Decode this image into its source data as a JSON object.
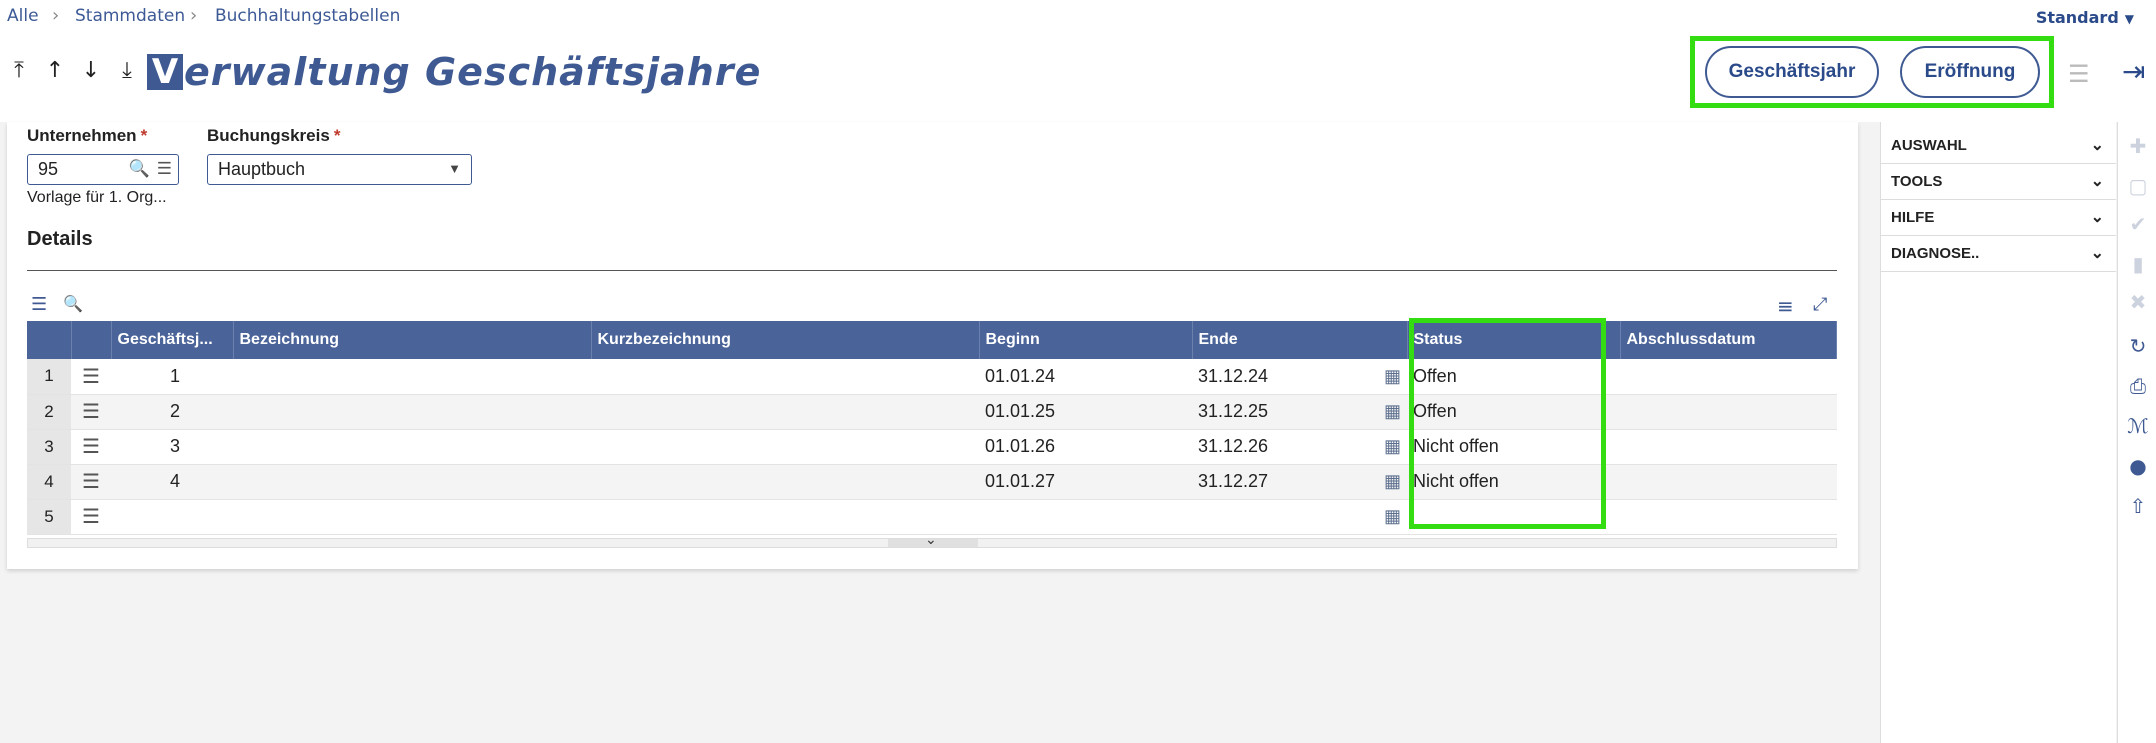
{
  "breadcrumb": {
    "items": [
      "Alle",
      "Stammdaten",
      "Buchhaltungstabellen"
    ]
  },
  "layout_selector": {
    "label": "Standard"
  },
  "title": {
    "logo_letter": "V",
    "text": "erwaltung Geschäftsjahre"
  },
  "header_buttons": {
    "fiscal_year": "Geschäftsjahr",
    "opening": "Eröffnung"
  },
  "form": {
    "company_label": "Unternehmen",
    "company_value": "95",
    "company_hint": "Vorlage für 1. Org...",
    "booking_label": "Buchungskreis",
    "booking_value": "Hauptbuch",
    "required_mark": "*"
  },
  "details_title": "Details",
  "table": {
    "columns": [
      "Geschäftsj...",
      "Bezeichnung",
      "Kurzbezeichnung",
      "Beginn",
      "Ende",
      "Status",
      "Abschlussdatum"
    ],
    "rows": [
      {
        "n": "1",
        "year": "1",
        "begin": "01.01.24",
        "end": "31.12.24",
        "status": "Offen"
      },
      {
        "n": "2",
        "year": "2",
        "begin": "01.01.25",
        "end": "31.12.25",
        "status": "Offen"
      },
      {
        "n": "3",
        "year": "3",
        "begin": "01.01.26",
        "end": "31.12.26",
        "status": "Nicht offen"
      },
      {
        "n": "4",
        "year": "4",
        "begin": "01.01.27",
        "end": "31.12.27",
        "status": "Nicht offen"
      },
      {
        "n": "5",
        "year": "",
        "begin": "",
        "end": "",
        "status": ""
      }
    ]
  },
  "right_panel": {
    "sections": [
      "AUSWAHL",
      "TOOLS",
      "HILFE",
      "DIAGNOSE.."
    ]
  },
  "colors": {
    "accent": "#3f5a93",
    "highlight": "#33dd11",
    "header_bg": "#4a6399"
  }
}
